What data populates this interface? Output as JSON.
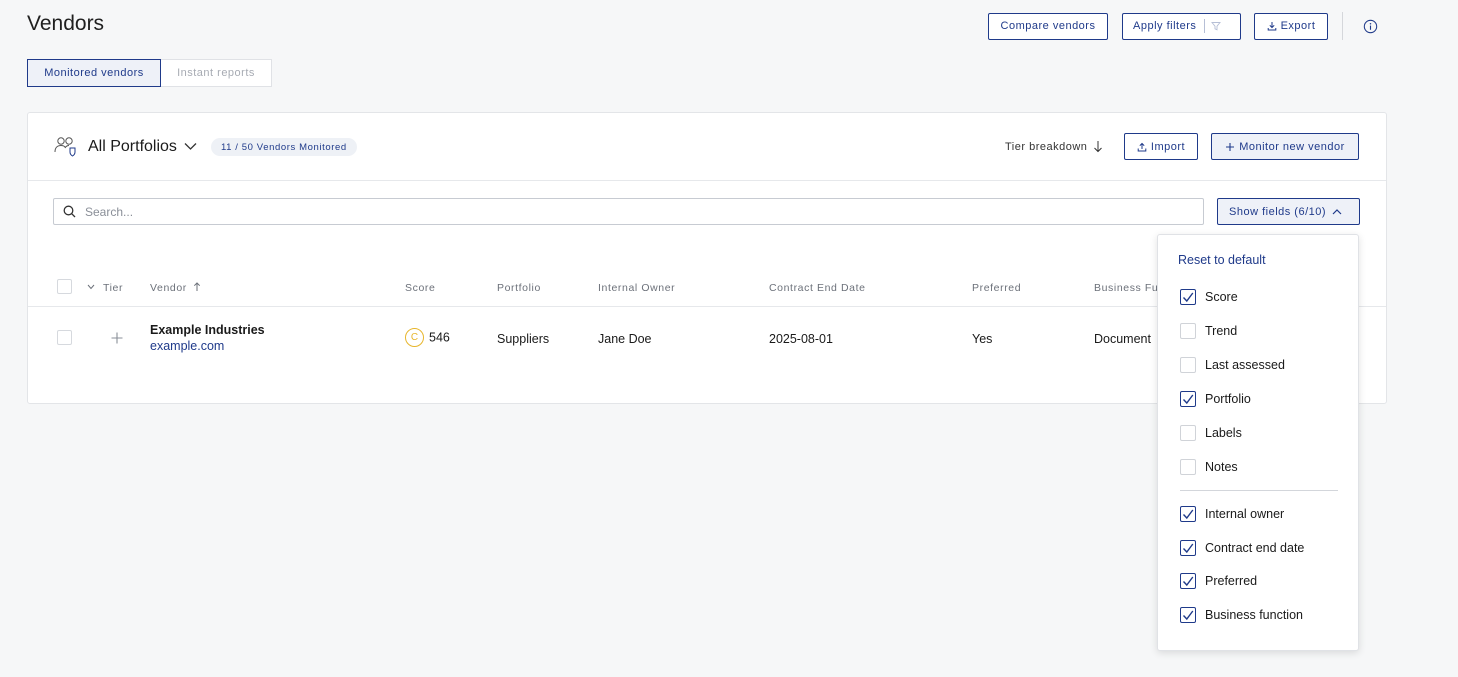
{
  "page": {
    "title": "Vendors"
  },
  "top_actions": {
    "compare": "Compare vendors",
    "filters": "Apply filters",
    "export": "Export"
  },
  "tabs": [
    {
      "label": "Monitored vendors",
      "active": true
    },
    {
      "label": "Instant reports",
      "active": false
    }
  ],
  "card": {
    "portfolio_title": "All Portfolios",
    "badge": "11 / 50 Vendors Monitored",
    "tier_breakdown": "Tier breakdown",
    "import": "Import",
    "monitor_new": "Monitor new vendor"
  },
  "search": {
    "placeholder": "Search..."
  },
  "show_fields": "Show fields (6/10)",
  "table": {
    "headers": {
      "tier": "Tier",
      "vendor": "Vendor",
      "score": "Score",
      "portfolio": "Portfolio",
      "internal_owner": "Internal Owner",
      "contract_end": "Contract End Date",
      "preferred": "Preferred",
      "business_function": "Business Fu"
    },
    "rows": [
      {
        "vendor_name": "Example Industries",
        "vendor_domain": "example.com",
        "score_grade": "C",
        "score": "546",
        "portfolio": "Suppliers",
        "internal_owner": "Jane Doe",
        "contract_end": "2025-08-01",
        "preferred": "Yes",
        "business_function": "Document"
      }
    ]
  },
  "fields_menu": {
    "reset": "Reset to default",
    "options": [
      {
        "label": "Score",
        "checked": true
      },
      {
        "label": "Trend",
        "checked": false
      },
      {
        "label": "Last assessed",
        "checked": false
      },
      {
        "label": "Portfolio",
        "checked": true
      },
      {
        "label": "Labels",
        "checked": false
      },
      {
        "label": "Notes",
        "checked": false
      },
      {
        "label": "Internal owner",
        "checked": true
      },
      {
        "label": "Contract end date",
        "checked": true
      },
      {
        "label": "Preferred",
        "checked": true
      },
      {
        "label": "Business function",
        "checked": true
      }
    ]
  },
  "colors": {
    "accent": "#1f3a8a",
    "grade_c": "#e7b62d",
    "background": "#f6f7f8"
  },
  "icons": [
    "filter-icon",
    "export-icon",
    "info-icon",
    "portfolio-users-icon",
    "chevron-down-icon",
    "arrow-down-icon",
    "upload-icon",
    "plus-icon",
    "search-icon",
    "chevron-up-icon",
    "sort-up-icon",
    "expand-plus-icon",
    "checkmark-icon"
  ]
}
